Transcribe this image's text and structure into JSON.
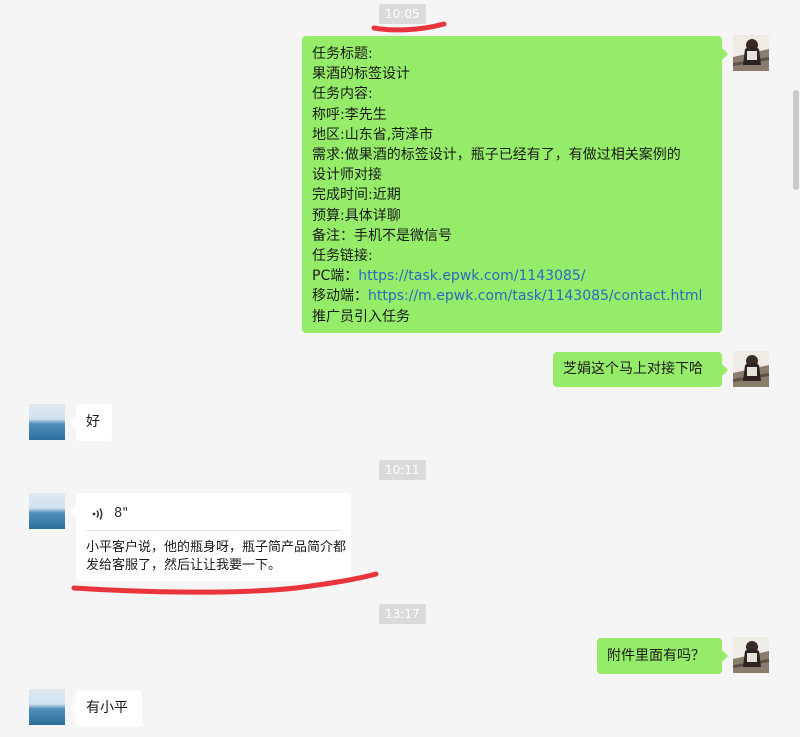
{
  "times": [
    "10:05",
    "10:11",
    "13:17"
  ],
  "messages": {
    "task": {
      "lines": [
        "任务标题:",
        "果酒的标签设计",
        "任务内容:",
        "称呼:李先生",
        "地区:山东省,菏泽市",
        "需求:做果酒的标签设计，瓶子已经有了，有做过相关案例的",
        "设计师对接",
        "完成时间:近期",
        "预算:具体详聊",
        "备注：手机不是微信号",
        "任务链接:"
      ],
      "pc_label": "PC端：",
      "pc_url": "https://task.epwk.com/1143085/",
      "mobile_label": "移动端：",
      "mobile_url": "https://m.epwk.com/task/1143085/contact.html",
      "footer": "推广员引入任务"
    },
    "m2": "芝娟这个马上对接下哈",
    "m3": "好",
    "voice": {
      "icon": "voice-wave-icon",
      "duration": "8\"",
      "transcript_line1": "小平客户说，他的瓶身呀，瓶子简产品简介都",
      "transcript_line2": "发给客服了，然后让让我要一下。"
    },
    "m5": "附件里面有吗？",
    "m6": "有小平"
  },
  "colors": {
    "outgoing_bubble": "#95ec69",
    "incoming_bubble": "#ffffff",
    "background": "#f5f5f5",
    "annotation_red": "#e8343a",
    "link": "#2a6ac0"
  }
}
